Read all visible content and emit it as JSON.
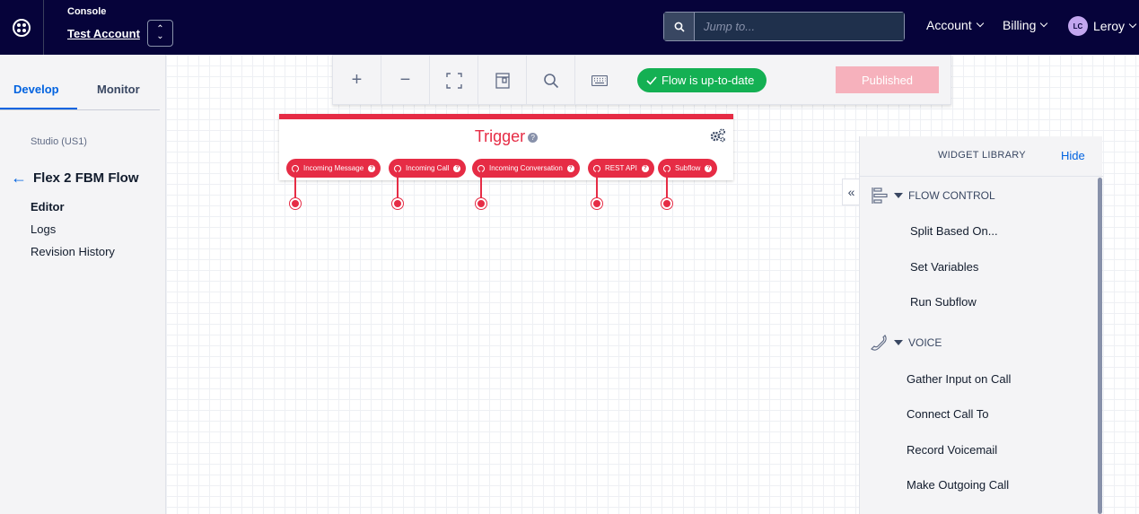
{
  "header": {
    "console_label": "Console",
    "account_name": "Test Account",
    "search_placeholder": "Jump to...",
    "nav": {
      "account": "Account",
      "billing": "Billing",
      "user_initials": "LC",
      "user_name": "Leroy"
    }
  },
  "sidebar": {
    "tabs": [
      {
        "label": "Develop",
        "active": true
      },
      {
        "label": "Monitor",
        "active": false
      }
    ],
    "region": "Studio (US1)",
    "flow_name": "Flex 2 FBM Flow",
    "links": [
      {
        "label": "Editor",
        "active": true
      },
      {
        "label": "Logs"
      },
      {
        "label": "Revision History"
      }
    ]
  },
  "toolbar": {
    "tools": [
      "zoom-in-icon",
      "zoom-out-icon",
      "fit-screen-icon",
      "widget-notes-icon",
      "search-icon",
      "keyboard-icon"
    ],
    "status": "Flow is up-to-date",
    "publish_label": "Published",
    "colors": {
      "status": "#14b053",
      "publish": "#f6b1bc"
    }
  },
  "trigger": {
    "title": "Trigger",
    "color": "#e62c45",
    "transitions": [
      "Incoming Message",
      "Incoming Call",
      "Incoming Conversation",
      "REST API",
      "Subflow"
    ]
  },
  "library": {
    "title": "WIDGET LIBRARY",
    "hide_label": "Hide",
    "categories": [
      {
        "name": "FLOW CONTROL",
        "icon": "flow-control-icon",
        "items": [
          "Split Based On...",
          "Set Variables",
          "Run Subflow"
        ]
      },
      {
        "name": "VOICE",
        "icon": "phone-icon",
        "items": [
          "Gather Input on Call",
          "Connect Call To",
          "Record Voicemail",
          "Make Outgoing Call"
        ]
      }
    ]
  }
}
